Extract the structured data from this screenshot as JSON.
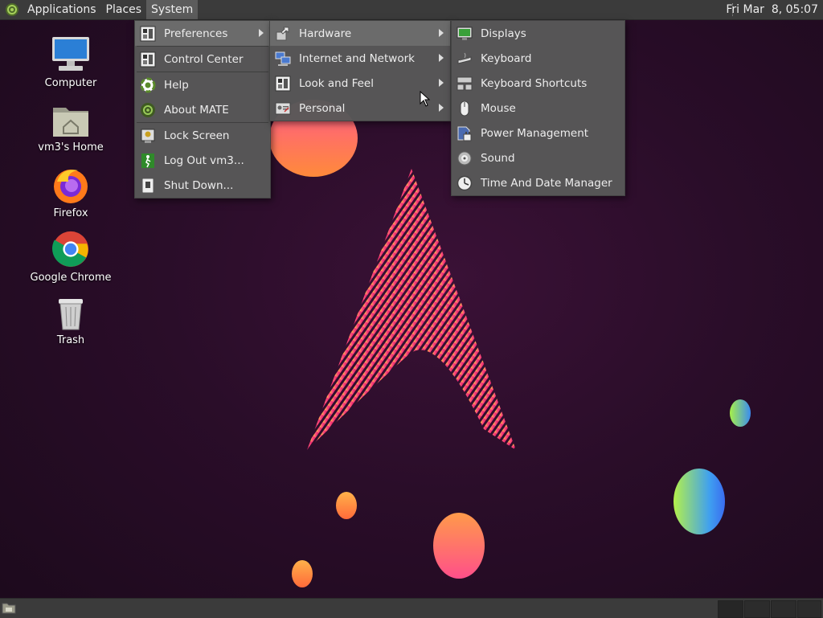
{
  "top_panel": {
    "menus": [
      "Applications",
      "Places",
      "System"
    ],
    "clock": "Fri Mar  8, 05:07"
  },
  "desktop": {
    "icons": [
      {
        "label": "Computer",
        "icon": "computer-icon"
      },
      {
        "label": "vm3's Home",
        "icon": "home-folder-icon"
      },
      {
        "label": "Firefox",
        "icon": "firefox-icon"
      },
      {
        "label": "Google Chrome",
        "icon": "chrome-icon"
      },
      {
        "label": "Trash",
        "icon": "trash-icon"
      }
    ]
  },
  "system_menu": {
    "items": [
      {
        "label": "Preferences",
        "icon": "preferences-icon",
        "submenu": true
      },
      {
        "label": "Control Center",
        "icon": "control-center-icon"
      },
      {
        "label": "Help",
        "icon": "help-icon"
      },
      {
        "label": "About MATE",
        "icon": "about-mate-icon"
      },
      {
        "label": "Lock Screen",
        "icon": "lock-screen-icon"
      },
      {
        "label": "Log Out vm3...",
        "icon": "logout-icon"
      },
      {
        "label": "Shut Down...",
        "icon": "shutdown-icon"
      }
    ]
  },
  "preferences_menu": {
    "items": [
      {
        "label": "Hardware",
        "icon": "hardware-icon",
        "submenu": true
      },
      {
        "label": "Internet and Network",
        "icon": "network-icon",
        "submenu": true
      },
      {
        "label": "Look and Feel",
        "icon": "look-and-feel-icon",
        "submenu": true
      },
      {
        "label": "Personal",
        "icon": "personal-icon",
        "submenu": true
      }
    ]
  },
  "hardware_menu": {
    "items": [
      {
        "label": "Displays",
        "icon": "displays-icon"
      },
      {
        "label": "Keyboard",
        "icon": "keyboard-icon"
      },
      {
        "label": "Keyboard Shortcuts",
        "icon": "keyboard-shortcuts-icon"
      },
      {
        "label": "Mouse",
        "icon": "mouse-icon"
      },
      {
        "label": "Power Management",
        "icon": "power-management-icon"
      },
      {
        "label": "Sound",
        "icon": "sound-icon"
      },
      {
        "label": "Time And Date Manager",
        "icon": "clock-icon"
      }
    ]
  }
}
